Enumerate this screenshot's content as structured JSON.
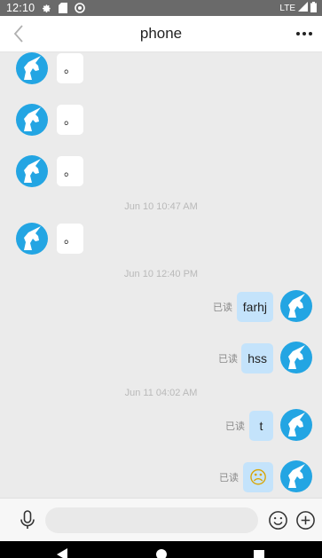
{
  "status_bar": {
    "time": "12:10",
    "network": "LTE"
  },
  "header": {
    "title": "phone"
  },
  "messages": [
    {
      "direction": "in",
      "text": "。"
    },
    {
      "direction": "in",
      "text": "。"
    },
    {
      "direction": "in",
      "text": "。"
    },
    {
      "timestamp": "Jun 10 10:47 AM"
    },
    {
      "direction": "in",
      "text": "。"
    },
    {
      "timestamp": "Jun 10 12:40 PM"
    },
    {
      "direction": "out",
      "text": "farhj",
      "status": "已读"
    },
    {
      "direction": "out",
      "text": "hss",
      "status": "已读"
    },
    {
      "timestamp": "Jun 11 04:02 AM"
    },
    {
      "direction": "out",
      "text": "t",
      "status": "已读"
    },
    {
      "direction": "out",
      "emoji": "☹",
      "status": "已读"
    }
  ],
  "input": {
    "placeholder": ""
  },
  "colors": {
    "avatar_bg": "#23a5e3",
    "outgoing_bubble": "#c4e3fb",
    "chat_bg": "#ebebeb"
  }
}
